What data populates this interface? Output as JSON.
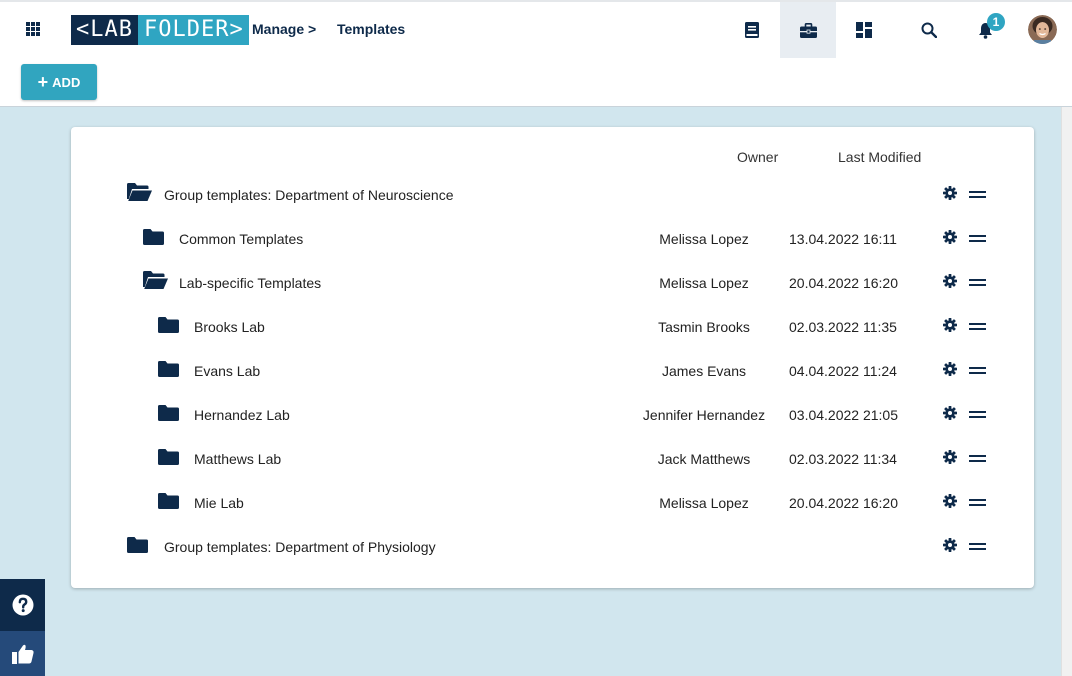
{
  "header": {
    "logo_left": "<LAB",
    "logo_right": "FOLDER>",
    "breadcrumb": [
      "Manage >",
      "Templates"
    ],
    "nav_icons": [
      "notebook-icon",
      "briefcase-icon",
      "dashboard-icon",
      "search-icon",
      "bell-icon"
    ],
    "active_nav": "briefcase-icon",
    "notification_count": "1",
    "accent_color": "#2fa5c2",
    "brand_color": "#0e2a4a"
  },
  "toolbar": {
    "add_label": "ADD"
  },
  "table": {
    "columns": {
      "owner": "Owner",
      "modified": "Last Modified"
    },
    "rows": [
      {
        "name": "Group templates: Department of Neuroscience",
        "owner": "",
        "modified": "",
        "level": 0,
        "open": true
      },
      {
        "name": "Common Templates",
        "owner": "Melissa Lopez",
        "modified": "13.04.2022 16:11",
        "level": 1,
        "open": false
      },
      {
        "name": "Lab-specific Templates",
        "owner": "Melissa Lopez",
        "modified": "20.04.2022 16:20",
        "level": 1,
        "open": true
      },
      {
        "name": "Brooks Lab",
        "owner": "Tasmin Brooks",
        "modified": "02.03.2022 11:35",
        "level": 2,
        "open": false
      },
      {
        "name": "Evans Lab",
        "owner": "James Evans",
        "modified": "04.04.2022 11:24",
        "level": 2,
        "open": false
      },
      {
        "name": "Hernandez Lab",
        "owner": "Jennifer Hernandez",
        "modified": "03.04.2022 21:05",
        "level": 2,
        "open": false
      },
      {
        "name": "Matthews Lab",
        "owner": "Jack Matthews",
        "modified": "02.03.2022 11:34",
        "level": 2,
        "open": false
      },
      {
        "name": "Mie Lab",
        "owner": "Melissa Lopez",
        "modified": "20.04.2022 16:20",
        "level": 2,
        "open": false
      },
      {
        "name": "Group templates: Department of Physiology",
        "owner": "",
        "modified": "",
        "level": 0,
        "open": false
      }
    ]
  },
  "side": {
    "help_icon": "help-icon",
    "feedback_icon": "thumbs-up-icon"
  }
}
